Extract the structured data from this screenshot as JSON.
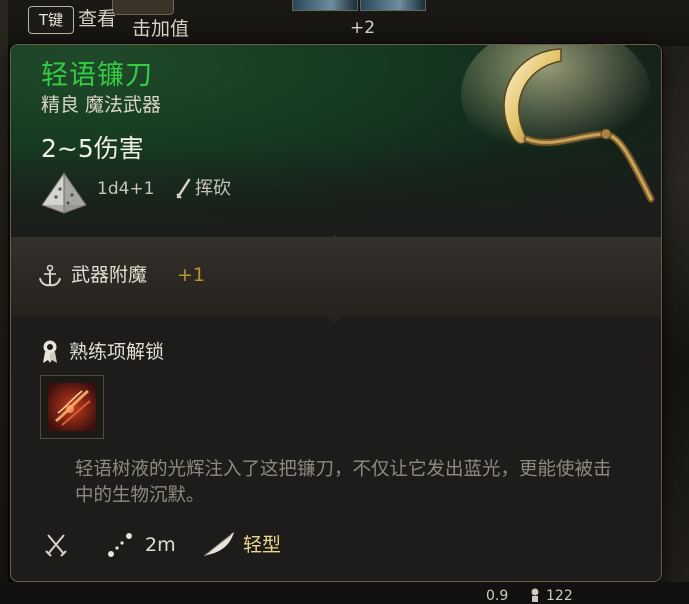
{
  "top_bar": {
    "key_badge": "T键",
    "view_label": "查看",
    "hit_bonus_label": "击加值",
    "plus_count": "+2"
  },
  "item": {
    "name": "轻语镰刀",
    "rarity_type": "精良 魔法武器",
    "damage": "2~5伤害",
    "dice": "1d4+1",
    "attack_type": "挥砍",
    "name_color": "#33cc44"
  },
  "enchant": {
    "label": "武器附魔",
    "value": "+1"
  },
  "proficiency": {
    "label": "熟练项解锁",
    "skill_icon": "crimson-slash-icon"
  },
  "description": "轻语树液的光辉注入了这把镰刀，不仅让它发出蓝光，更能使被击中的生物沉默。",
  "footer": {
    "range": "2m",
    "weight_class": "轻型"
  },
  "bottom_bar": {
    "left_value": "0.9",
    "right_value": "122"
  },
  "icons": {
    "dice": "d4-dice-icon",
    "attack": "slash-icon",
    "enchant": "anchor-icon",
    "proficiency": "medal-icon",
    "weapon_type": "crossed-swords-icon",
    "range": "range-dots-icon",
    "weight": "feather-icon",
    "item": "sickle-icon"
  }
}
